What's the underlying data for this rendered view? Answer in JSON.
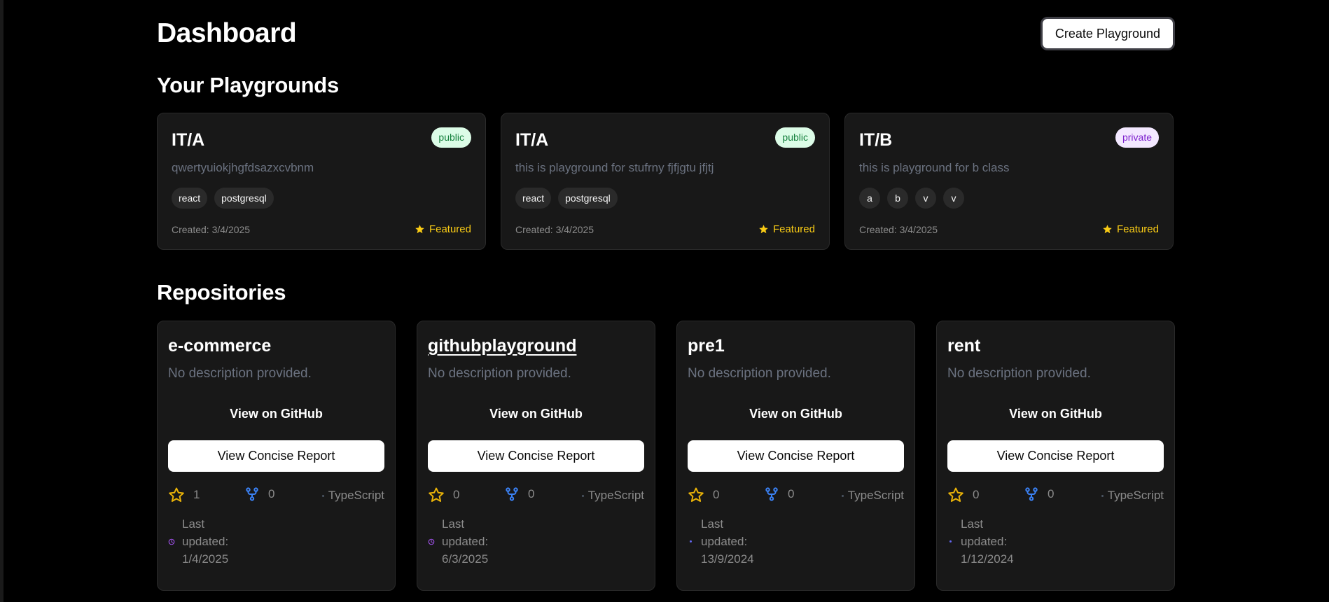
{
  "header": {
    "title": "Dashboard",
    "create_button": "Create Playground"
  },
  "playgrounds": {
    "section_title": "Your Playgrounds",
    "items": [
      {
        "name": "IT/A",
        "visibility": "public",
        "description": "qwertyuiokjhgfdsazxcvbnm",
        "tags": [
          "react",
          "postgresql"
        ],
        "created": "Created: 3/4/2025",
        "featured": "Featured"
      },
      {
        "name": "IT/A",
        "visibility": "public",
        "description": "this is playground for stufrny fjfjgtu jfjtj",
        "tags": [
          "react",
          "postgresql"
        ],
        "created": "Created: 3/4/2025",
        "featured": "Featured"
      },
      {
        "name": "IT/B",
        "visibility": "private",
        "description": "this is playground for b class",
        "tags": [
          "a",
          "b",
          "v",
          "v"
        ],
        "created": "Created: 3/4/2025",
        "featured": "Featured"
      }
    ]
  },
  "repositories": {
    "section_title": "Repositories",
    "items": [
      {
        "name": "e-commerce",
        "description": "No description provided.",
        "github_link": "View on GitHub",
        "report_button": "View Concise Report",
        "stars": "1",
        "forks": "0",
        "language": "TypeScript",
        "updated": "Last updated: 1/4/2025",
        "updated_icon": "clock-icon",
        "updated_color": "#a855f7"
      },
      {
        "name": "githubplayground",
        "description": "No description provided.",
        "github_link": "View on GitHub",
        "report_button": "View Concise Report",
        "stars": "0",
        "forks": "0",
        "language": "TypeScript",
        "updated": "Last updated: 6/3/2025",
        "updated_icon": "clock-icon",
        "updated_color": "#a855f7"
      },
      {
        "name": "pre1",
        "description": "No description provided.",
        "github_link": "View on GitHub",
        "report_button": "View Concise Report",
        "stars": "0",
        "forks": "0",
        "language": "TypeScript",
        "updated": "Last updated: 13/9/2024",
        "updated_icon": "dot-icon",
        "updated_color": "#6366f1"
      },
      {
        "name": "rent",
        "description": "No description provided.",
        "github_link": "View on GitHub",
        "report_button": "View Concise Report",
        "stars": "0",
        "forks": "0",
        "language": "TypeScript",
        "updated": "Last updated: 1/12/2024",
        "updated_icon": "dot-icon",
        "updated_color": "#6366f1"
      }
    ]
  },
  "colors": {
    "background": "#000000",
    "card": "#181818",
    "star": "#eab308",
    "fork": "#3b82f6",
    "featured": "#facc15"
  }
}
